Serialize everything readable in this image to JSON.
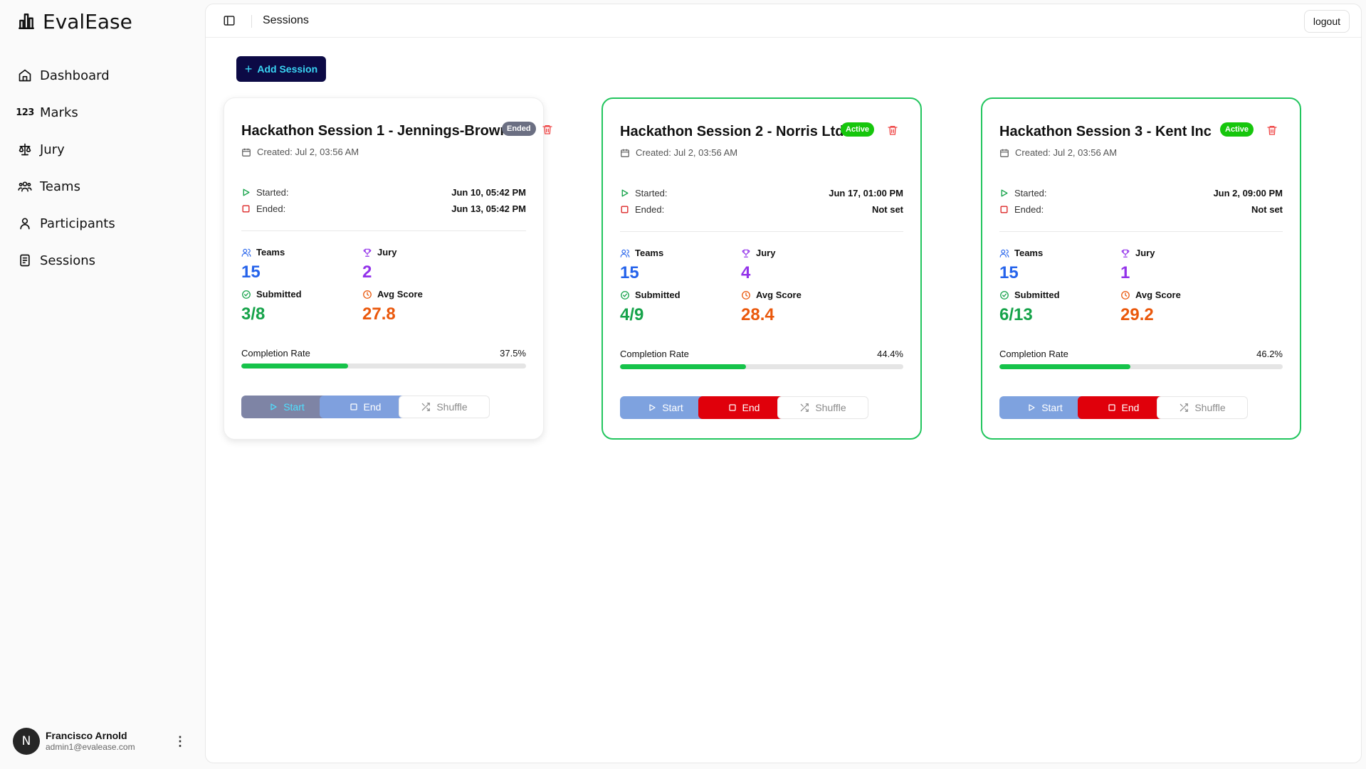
{
  "app": {
    "name": "EvalEase"
  },
  "sidebar": {
    "items": [
      {
        "label": "Dashboard",
        "icon": "home-icon"
      },
      {
        "label": "Marks",
        "icon": "numbers-icon",
        "icon_text": "123"
      },
      {
        "label": "Jury",
        "icon": "scale-icon"
      },
      {
        "label": "Teams",
        "icon": "users-icon"
      },
      {
        "label": "Participants",
        "icon": "user-icon"
      },
      {
        "label": "Sessions",
        "icon": "clipboard-icon"
      }
    ]
  },
  "user": {
    "initial": "N",
    "name": "Francisco Arnold",
    "email": "admin1@evalease.com",
    "menu_glyph": "⋮"
  },
  "header": {
    "title": "Sessions",
    "logout_label": "logout"
  },
  "add_session_label": "Add Session",
  "labels": {
    "started": "Started:",
    "ended": "Ended:",
    "teams": "Teams",
    "jury": "Jury",
    "submitted": "Submitted",
    "avg_score": "Avg Score",
    "completion_rate": "Completion Rate",
    "start": "Start",
    "end": "End",
    "shuffle": "Shuffle"
  },
  "colors": {
    "active_border": "#22c55e",
    "active_badge": "#16c60c",
    "end_button": "#e0000b",
    "add_button": "#0c0a45"
  },
  "sessions": [
    {
      "title": "Hackathon Session 1 - Jennings-Brown",
      "status": "Ended",
      "created": "Created: Jul 2, 03:56 AM",
      "started": "Jun 10, 05:42 PM",
      "ended": "Jun 13, 05:42 PM",
      "teams": "15",
      "jury": "2",
      "submitted": "3/8",
      "avg_score": "27.8",
      "completion_label": "37.5%",
      "completion_rate": 37.5
    },
    {
      "title": "Hackathon Session 2 - Norris Ltd",
      "status": "Active",
      "created": "Created: Jul 2, 03:56 AM",
      "started": "Jun 17, 01:00 PM",
      "ended": "Not set",
      "teams": "15",
      "jury": "4",
      "submitted": "4/9",
      "avg_score": "28.4",
      "completion_label": "44.4%",
      "completion_rate": 44.4
    },
    {
      "title": "Hackathon Session 3 - Kent Inc",
      "status": "Active",
      "created": "Created: Jul 2, 03:56 AM",
      "started": "Jun 2, 09:00 PM",
      "ended": "Not set",
      "teams": "15",
      "jury": "1",
      "submitted": "6/13",
      "avg_score": "29.2",
      "completion_label": "46.2%",
      "completion_rate": 46.2
    }
  ]
}
